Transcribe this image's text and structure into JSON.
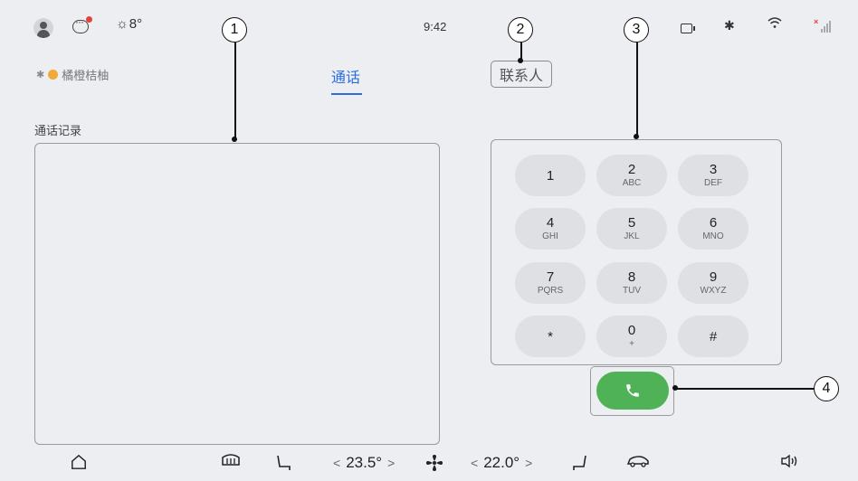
{
  "status_bar": {
    "weather_temp": "8°",
    "time": "9:42",
    "icons": [
      "avatar",
      "message-icon",
      "weather-icon",
      "battery-icon",
      "bluetooth-icon",
      "wifi-icon",
      "signal-icon"
    ]
  },
  "header": {
    "device_name": "橘橙桔柚",
    "tab_call": "通话",
    "tab_contacts": "联系人"
  },
  "call_history": {
    "title": "通话记录"
  },
  "dialpad": {
    "keys": [
      {
        "digit": "1",
        "letters": ""
      },
      {
        "digit": "2",
        "letters": "ABC"
      },
      {
        "digit": "3",
        "letters": "DEF"
      },
      {
        "digit": "4",
        "letters": "GHI"
      },
      {
        "digit": "5",
        "letters": "JKL"
      },
      {
        "digit": "6",
        "letters": "MNO"
      },
      {
        "digit": "7",
        "letters": "PQRS"
      },
      {
        "digit": "8",
        "letters": "TUV"
      },
      {
        "digit": "9",
        "letters": "WXYZ"
      },
      {
        "digit": "*",
        "letters": ""
      },
      {
        "digit": "0",
        "letters": "+"
      },
      {
        "digit": "#",
        "letters": ""
      }
    ]
  },
  "callouts": [
    "1",
    "2",
    "3",
    "4"
  ],
  "bottom_bar": {
    "left_temp": "23.5°",
    "right_temp": "22.0°",
    "chev_left": "<",
    "chev_right": ">"
  },
  "colors": {
    "accent": "#2b6de0",
    "call_green": "#4fb257",
    "background": "#eceef2",
    "key_bg": "#dee0e4"
  }
}
